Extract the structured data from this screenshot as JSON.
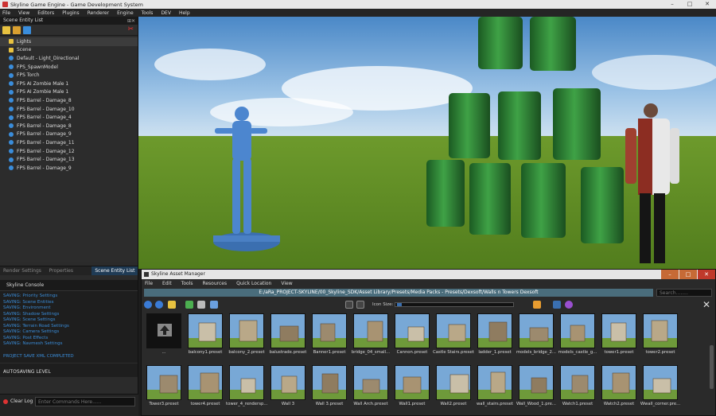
{
  "window": {
    "title": "Skyline Game Engine - Game Development System"
  },
  "menu": [
    "File",
    "View",
    "Editors",
    "Plugins",
    "Renderer",
    "Engine",
    "Tools",
    "DEV",
    "Help"
  ],
  "scene_panel": {
    "title": "Scene Entity List",
    "entities": [
      {
        "label": "Lights",
        "kind": "folder"
      },
      {
        "label": "Scene",
        "kind": "folder"
      },
      {
        "label": "Default - Light_Directional",
        "kind": "ent"
      },
      {
        "label": "FPS_SpawnModel",
        "kind": "ent"
      },
      {
        "label": "FPS Torch",
        "kind": "ent"
      },
      {
        "label": "FPS AI Zombie Male 1",
        "kind": "ent"
      },
      {
        "label": "FPS AI Zombie Male 1",
        "kind": "ent"
      },
      {
        "label": "FPS Barrel - Damage_8",
        "kind": "ent"
      },
      {
        "label": "FPS Barrel - Damage_10",
        "kind": "ent"
      },
      {
        "label": "FPS Barrel - Damage_4",
        "kind": "ent"
      },
      {
        "label": "FPS Barrel - Damage_8",
        "kind": "ent"
      },
      {
        "label": "FPS Barrel - Damage_9",
        "kind": "ent"
      },
      {
        "label": "FPS Barrel - Damage_11",
        "kind": "ent"
      },
      {
        "label": "FPS Barrel - Damage_12",
        "kind": "ent"
      },
      {
        "label": "FPS Barrel - Damage_13",
        "kind": "ent"
      },
      {
        "label": "FPS Barrel - Damage_9",
        "kind": "ent"
      }
    ],
    "tabs": [
      "Render Settings",
      "Properties",
      "Scene Entity List"
    ]
  },
  "console": {
    "title": "Skyline Console",
    "lines": [
      "SAVING: Priority Settings",
      "SAVING: Scene Entities",
      "SAVING: Environment",
      "SAVING: Shadow Settings",
      "SAVING: Scene Settings",
      "SAVING: Terrain Road Settings",
      "SAVING: Camera Settings",
      "SAVING: Post Effects",
      "SAVING: Navmesh Settings"
    ],
    "done": "PROJECT SAVE XML COMPLETED",
    "autosave": "AUTOSAVING LEVEL",
    "clear_label": "Clear Log",
    "command_placeholder": "Enter Commands Here......"
  },
  "asset_manager": {
    "title": "Skyline Asset Manager",
    "menu": [
      "File",
      "Edit",
      "Tools",
      "Resources",
      "Quick Location",
      "View"
    ],
    "path": "E:/aRa_PROJECT-SKYLINE/00_Skyline_SDK/Asset Library/Presets/Media Packs - Presets/Dexsoft/Walls n Towers Dexsoft",
    "search_placeholder": "Search........",
    "icon_size_label": "Icon Size:",
    "up_label": "...",
    "row1": [
      "balcony1.preset",
      "balcony_2.preset",
      "balustrade.preset",
      "Banner1.preset",
      "bridge_04_small...",
      "Cannon.preset",
      "Castle Stairs.preset",
      "ladder_1.preset",
      "models_bridge_2...",
      "models_castle_g...",
      "tower1.preset",
      "tower2.preset"
    ],
    "row2": [
      "Tower3.preset",
      "tower4.preset",
      "tower_4_rendersp...",
      "Wall 3",
      "Wall 3.preset",
      "Wall Arch.preset",
      "Wall1.preset",
      "Wall2.preset",
      "wall_stairs.preset",
      "Wall_Wood_1.pre...",
      "Watch1.preset",
      "Watch2.preset",
      "Wwall_corner.pre..."
    ]
  },
  "colors": {
    "accent": "#1f3b55",
    "path_bg": "#4a6d7c",
    "console_text": "#3a8cd8"
  }
}
